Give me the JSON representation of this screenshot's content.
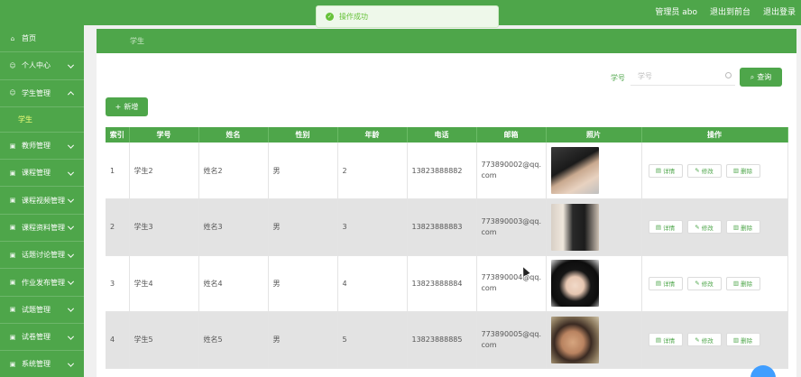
{
  "header": {
    "links": [
      "管理员 abo",
      "退出到前台",
      "退出登录"
    ]
  },
  "toast": {
    "text": "操作成功"
  },
  "sidebar": {
    "items": [
      {
        "label": "首页",
        "icon": "home-icon",
        "chev": ""
      },
      {
        "label": "个人中心",
        "icon": "user-icon",
        "chev": "down"
      },
      {
        "label": "学生管理",
        "icon": "user-icon",
        "chev": "up"
      },
      {
        "label": "教师管理",
        "icon": "folder-icon",
        "chev": "down"
      },
      {
        "label": "课程管理",
        "icon": "folder-icon",
        "chev": "down"
      },
      {
        "label": "课程视频管理",
        "icon": "folder-icon",
        "chev": "down"
      },
      {
        "label": "课程资料管理",
        "icon": "folder-icon",
        "chev": "down"
      },
      {
        "label": "话题讨论管理",
        "icon": "folder-icon",
        "chev": "down"
      },
      {
        "label": "作业发布管理",
        "icon": "folder-icon",
        "chev": "down"
      },
      {
        "label": "试题管理",
        "icon": "folder-icon",
        "chev": "down"
      },
      {
        "label": "试卷管理",
        "icon": "folder-icon",
        "chev": "down"
      },
      {
        "label": "系统管理",
        "icon": "folder-icon",
        "chev": "down"
      }
    ],
    "subitem": "学生"
  },
  "breadcrumb": "学生",
  "search": {
    "label": "学号",
    "placeholder": "学号",
    "button": "查询"
  },
  "add_button": "新增",
  "table": {
    "headers": [
      "索引",
      "学号",
      "姓名",
      "性别",
      "年龄",
      "电话",
      "邮箱",
      "照片",
      "操作"
    ],
    "rows": [
      {
        "index": "1",
        "sid": "学生2",
        "name": "姓名2",
        "gender": "男",
        "age": "2",
        "phone": "13823888882",
        "email": "773890002@qq.com",
        "photo": "photo-portrait-1"
      },
      {
        "index": "2",
        "sid": "学生3",
        "name": "姓名3",
        "gender": "男",
        "age": "3",
        "phone": "13823888883",
        "email": "773890003@qq.com",
        "photo": "photo-portrait-2"
      },
      {
        "index": "3",
        "sid": "学生4",
        "name": "姓名4",
        "gender": "男",
        "age": "4",
        "phone": "13823888884",
        "email": "773890004@qq.com",
        "photo": "photo-portrait-3"
      },
      {
        "index": "4",
        "sid": "学生5",
        "name": "姓名5",
        "gender": "男",
        "age": "5",
        "phone": "13823888885",
        "email": "773890005@qq.com",
        "photo": "photo-portrait-4"
      }
    ],
    "actions": [
      "详情",
      "修改",
      "删除"
    ]
  },
  "colors": {
    "primary": "#4ea64a",
    "toast": "#67c23a",
    "subitem": "#f3ff7a"
  }
}
